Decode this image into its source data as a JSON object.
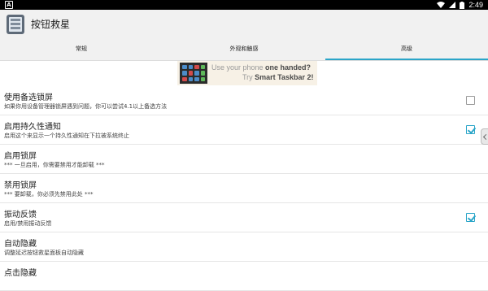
{
  "status_bar": {
    "time": "2:49",
    "icons": [
      "notification-a-icon",
      "wifi-icon",
      "signal-icon",
      "battery-icon"
    ]
  },
  "app": {
    "title": "按钮救星",
    "icon": "app-launcher-icon"
  },
  "tabs": [
    {
      "label": "常规",
      "active": false
    },
    {
      "label": "外观和触感",
      "active": false
    },
    {
      "label": "高级",
      "active": true
    }
  ],
  "ad": {
    "line1_prefix": "Use your phone ",
    "line1_emph": "one handed?",
    "line2_prefix": "Try ",
    "line2_emph": "Smart Taskbar 2!"
  },
  "settings": [
    {
      "title": "使用备选锁屏",
      "subtitle": "如果你用设备管理器锁屏遇到问题，你可以尝试4.1以上备选方法",
      "checkbox": true,
      "checked": false
    },
    {
      "title": "启用持久性通知",
      "subtitle": "启用这个来显示一个持久性通知在下拉被系统终止",
      "checkbox": true,
      "checked": true
    },
    {
      "title": "启用锁屏",
      "subtitle": "*** 一旦启用，你需要禁用才能卸载 ***",
      "checkbox": false,
      "checked": false
    },
    {
      "title": "禁用锁屏",
      "subtitle": "*** 要卸载，你必须先禁用此处 ***",
      "checkbox": false,
      "checked": false
    },
    {
      "title": "振动反馈",
      "subtitle": "启用/禁用振动反馈",
      "checkbox": true,
      "checked": true
    },
    {
      "title": "自动隐藏",
      "subtitle": "调整延迟按钮救星面板自动隐藏",
      "checkbox": false,
      "checked": false
    },
    {
      "title": "点击隐藏",
      "subtitle": "",
      "checkbox": false,
      "checked": false
    }
  ],
  "colors": {
    "accent": "#2aa5c8",
    "app_bar": "#f1f1f1",
    "status_bar": "#000000"
  }
}
